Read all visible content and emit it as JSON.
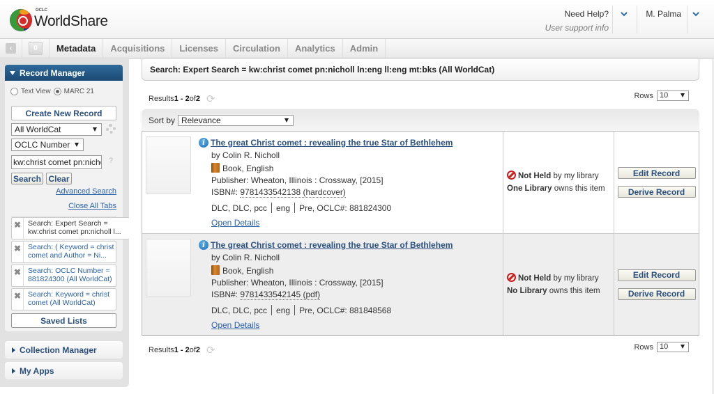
{
  "header": {
    "logo_small": "OCLC",
    "logo_name": "WorldShare",
    "help_title": "Need Help?",
    "help_sub": "User support info",
    "user_name": "M. Palma"
  },
  "nav": {
    "collapse_glyph": "‹",
    "count": "0",
    "tabs": [
      {
        "label": "Metadata",
        "active": true
      },
      {
        "label": "Acquisitions",
        "active": false
      },
      {
        "label": "Licenses",
        "active": false
      },
      {
        "label": "Circulation",
        "active": false
      },
      {
        "label": "Analytics",
        "active": false
      },
      {
        "label": "Admin",
        "active": false
      }
    ]
  },
  "sidebar": {
    "record_manager": {
      "title": "Record Manager",
      "view_options": [
        {
          "label": "Text View",
          "selected": false
        },
        {
          "label": "MARC 21",
          "selected": true
        }
      ],
      "create_label": "Create New Record",
      "scope_value": "All WorldCat",
      "index_value": "OCLC Number",
      "search_value": "kw:christ comet pn:nicholl ln:eng ll:eng mt:bks",
      "help_glyph": "?",
      "search_label": "Search",
      "clear_label": "Clear",
      "advanced_label": "Advanced Search",
      "close_tabs_label": "Close All Tabs",
      "open_tabs": [
        {
          "line1": "Search: Expert Search =",
          "line2": "kw:christ comet pn:nicholl l...",
          "current": true
        },
        {
          "line1": "Search: ( Keyword = christ",
          "line2": "comet and Author = Ni...",
          "current": false
        },
        {
          "line1": "Search: OCLC Number =",
          "line2": "881824300 (All WorldCat)",
          "current": false
        },
        {
          "line1": "Search: Keyword = christ",
          "line2": "comet (All WorldCat)",
          "current": false
        }
      ],
      "saved_lists_label": "Saved Lists"
    },
    "collection_manager": "Collection Manager",
    "my_apps": "My Apps"
  },
  "main": {
    "query": "Search: Expert Search = kw:christ comet pn:nicholl ln:eng ll:eng mt:bks (All WorldCat)",
    "results_prefix": "Results ",
    "results_range": "1 - 2",
    "results_of": " of ",
    "results_total": "2",
    "rows_label": "Rows",
    "rows_value": "10",
    "sort_label": "Sort by",
    "sort_value": "Relevance",
    "records": [
      {
        "title": "The great Christ comet : revealing the true Star of Bethlehem",
        "author": "by Colin R. Nicholl",
        "format": "Book, English",
        "publisher": "Publisher: Wheaton, Illinois : Crossway, [2015]",
        "isbn_label": "ISBN#: ",
        "isbn": "9781433542138 (hardcover)",
        "source": "DLC, DLC, pcc",
        "lang": "eng",
        "oclc": "Pre, OCLC#: 881824300",
        "open_details": "Open Details",
        "held_status": "Not Held",
        "held_suffix": " by my library",
        "owners_bold": "One Library",
        "owners_suffix": " owns this item",
        "edit_label": "Edit Record",
        "derive_label": "Derive Record"
      },
      {
        "title": "The great Christ comet : revealing the true Star of Bethlehem",
        "author": "by Colin R. Nicholl",
        "format": "Book, English",
        "publisher": "Publisher: Wheaton, Illinois : Crossway, [2015]",
        "isbn_label": "ISBN#: ",
        "isbn": "9781433542145 (pdf)",
        "source": "DLC, DLC, pcc",
        "lang": "eng",
        "oclc": "Pre, OCLC#: 881848568",
        "open_details": "Open Details",
        "held_status": "Not Held",
        "held_suffix": " by my library",
        "owners_bold": "No Library",
        "owners_suffix": " owns this item",
        "edit_label": "Edit Record",
        "derive_label": "Derive Record"
      }
    ]
  },
  "colors": {
    "brand_blue": "#1c4a73",
    "link_blue": "#2a62a8",
    "not_held_red": "#cc1c1c"
  }
}
